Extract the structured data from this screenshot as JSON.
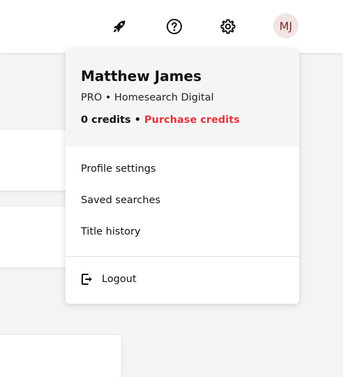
{
  "header": {
    "icons": [
      "rocket-icon",
      "help-icon",
      "gear-icon"
    ],
    "avatar_initials": "MJ"
  },
  "account_menu": {
    "user_name": "Matthew James",
    "plan_text": "PRO • Homesearch Digital",
    "credits_text": "0 credits",
    "credits_separator": " • ",
    "purchase_label": "Purchase credits",
    "items": [
      {
        "label": "Profile settings"
      },
      {
        "label": "Saved searches"
      },
      {
        "label": "Title history"
      }
    ],
    "logout_label": "Logout"
  },
  "colors": {
    "accent_red": "#e8323c",
    "avatar_bg": "#f1e4e4",
    "avatar_text": "#7a2f2f"
  }
}
